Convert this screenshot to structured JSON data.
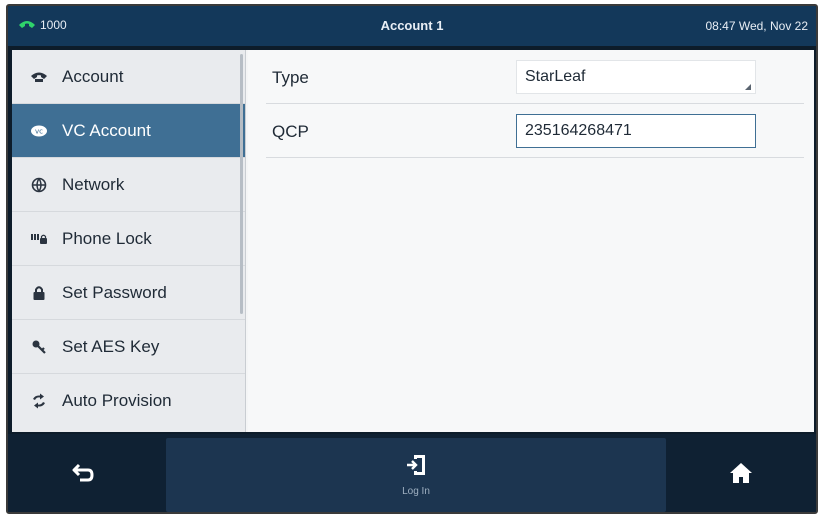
{
  "status_bar": {
    "line": "1000",
    "title": "Account 1",
    "clock": "08:47 Wed, Nov 22"
  },
  "sidebar": {
    "items": [
      {
        "label": "Account",
        "icon": "phone-icon"
      },
      {
        "label": "VC Account",
        "icon": "vc-icon"
      },
      {
        "label": "Network",
        "icon": "network-icon"
      },
      {
        "label": "Phone Lock",
        "icon": "phone-lock-icon"
      },
      {
        "label": "Set Password",
        "icon": "lock-icon"
      },
      {
        "label": "Set AES Key",
        "icon": "key-icon"
      },
      {
        "label": "Auto Provision",
        "icon": "refresh-icon"
      }
    ],
    "active_index": 1
  },
  "content": {
    "type_label": "Type",
    "type_value": "StarLeaf",
    "qcp_label": "QCP",
    "qcp_value": "235164268471"
  },
  "softkeys": {
    "login_label": "Log In"
  },
  "colors": {
    "status_bar": "#13385a",
    "active_item": "#3f6f94",
    "softkey_bar": "#0f2133",
    "line_icon": "#2fd36b"
  }
}
